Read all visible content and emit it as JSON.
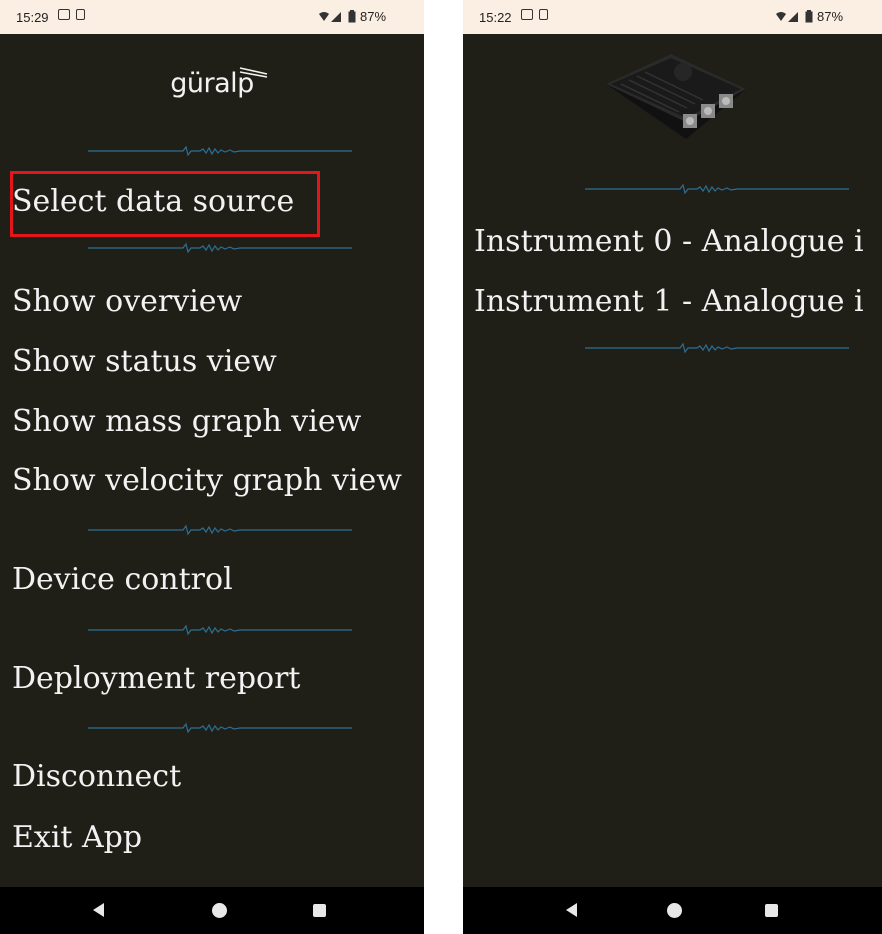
{
  "left_screen": {
    "status": {
      "time": "15:29",
      "battery": "87%"
    },
    "logo_text": "güralp",
    "menu": {
      "select_data_source": "Select data source",
      "show_overview": "Show overview",
      "show_status_view": "Show status view",
      "show_mass_graph_view": "Show mass graph view",
      "show_velocity_graph_view": "Show velocity graph view",
      "device_control": "Device control",
      "deployment_report": "Deployment report",
      "disconnect": "Disconnect",
      "exit_app": "Exit App"
    }
  },
  "right_screen": {
    "status": {
      "time": "15:22",
      "battery": "87%"
    },
    "instruments": [
      "Instrument 0 - Analogue i",
      "Instrument 1 - Analogue i"
    ]
  },
  "colors": {
    "background": "#1f1f18",
    "status_bar": "#fbeee3",
    "highlight": "#e3171b",
    "wave": "#2c6f93"
  },
  "icons": [
    "sim-icon",
    "signal-icon",
    "battery-icon",
    "back-icon",
    "home-icon",
    "recents-icon"
  ]
}
